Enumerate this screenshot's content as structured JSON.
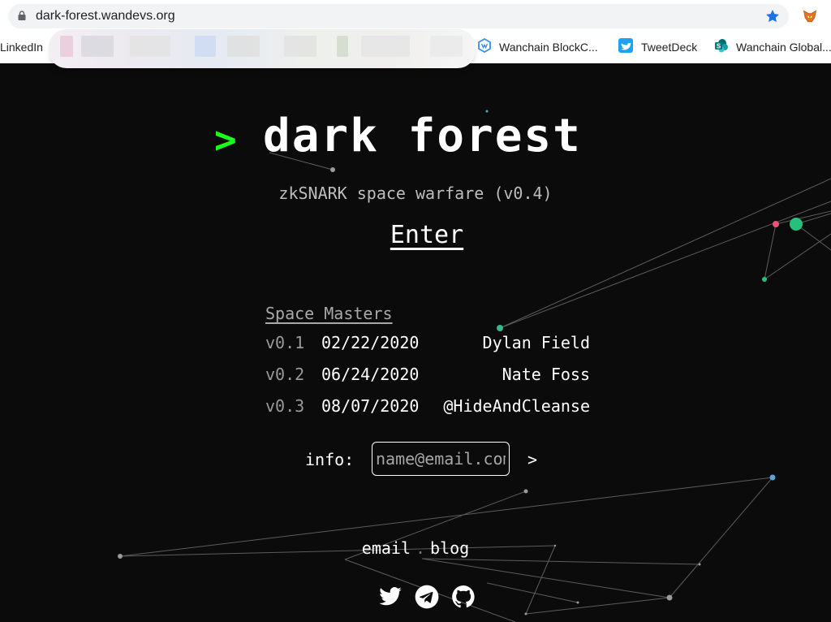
{
  "browser": {
    "url": "dark-forest.wandevs.org",
    "bookmarks": [
      {
        "label": "LinkedIn"
      },
      {
        "label": "Wanchain BlockC..."
      },
      {
        "label": "TweetDeck"
      },
      {
        "label": "Wanchain Global..."
      }
    ],
    "icons": {
      "lock": "lock-icon",
      "star": "star-icon",
      "extension": "metamask-fox-icon"
    }
  },
  "logo": {
    "arrow": ">",
    "title": "dark forest",
    "arrow_color": "#1aff1a"
  },
  "subtitle": "zkSNARK space warfare (v0.4)",
  "enter_label": "Enter",
  "space_masters": {
    "heading": "Space Masters",
    "rows": [
      {
        "version": "v0.1",
        "date": "02/22/2020",
        "name": "Dylan Field"
      },
      {
        "version": "v0.2",
        "date": "06/24/2020",
        "name": "Nate Foss"
      },
      {
        "version": "v0.3",
        "date": "08/07/2020",
        "name": "@HideAndCleanse"
      }
    ]
  },
  "info": {
    "label": "info:",
    "placeholder": "name@email.com",
    "submit": ">"
  },
  "footer": {
    "email_label": "email",
    "separator": ".",
    "blog_label": "blog",
    "social_icons": [
      "twitter-icon",
      "telegram-icon",
      "github-icon"
    ]
  },
  "colors": {
    "background": "#0b0b0b",
    "accent_green": "#1aff1a",
    "node_green": "#27c07a",
    "node_pink": "#e8537a",
    "node_blue": "#5aa5d6"
  }
}
